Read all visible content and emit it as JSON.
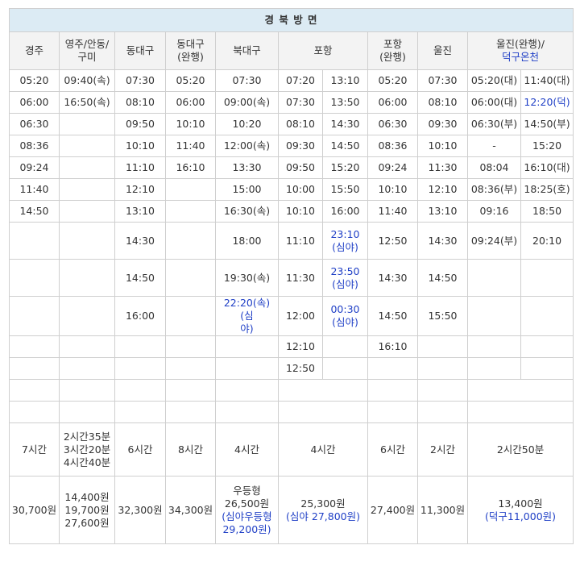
{
  "title": "경 북 방 면",
  "headers": {
    "gyeongju": "경주",
    "yeongju_1": "영주/안동/",
    "yeongju_2": "구미",
    "dongdaegu": "동대구",
    "dongdaegu_express_1": "동대구",
    "dongdaegu_express_2": "(완행)",
    "bukdaegu": "북대구",
    "pohang": "포항",
    "pohang_express_1": "포항",
    "pohang_express_2": "(완행)",
    "uljin": "울진",
    "uljin_express_1": "울진(완행)/",
    "uljin_express_2": "덕구온천"
  },
  "rows": [
    {
      "c1": "05:20",
      "c2": "09:40(속)",
      "c3": "07:30",
      "c4": "05:20",
      "c5": "07:30",
      "c6a": "07:20",
      "c6b": "13:10",
      "c7": "05:20",
      "c8": "07:30",
      "c9a": "05:20(대)",
      "c9b": "11:40(대)"
    },
    {
      "c1": "06:00",
      "c2": "16:50(속)",
      "c3": "08:10",
      "c4": "06:00",
      "c5": "09:00(속)",
      "c6a": "07:30",
      "c6b": "13:50",
      "c7": "06:00",
      "c8": "08:10",
      "c9a": "06:00(대)",
      "c9b": "12:20(덕)"
    },
    {
      "c1": "06:30",
      "c2": "",
      "c3": "09:50",
      "c4": "10:10",
      "c5": "10:20",
      "c6a": "08:10",
      "c6b": "14:30",
      "c7": "06:30",
      "c8": "09:30",
      "c9a": "06:30(부)",
      "c9b": "14:50(부)"
    },
    {
      "c1": "08:36",
      "c2": "",
      "c3": "10:10",
      "c4": "11:40",
      "c5": "12:00(속)",
      "c6a": "09:30",
      "c6b": "14:50",
      "c7": "08:36",
      "c8": "10:10",
      "c9a": "-",
      "c9b": "15:20"
    },
    {
      "c1": "09:24",
      "c2": "",
      "c3": "11:10",
      "c4": "16:10",
      "c5": "13:30",
      "c6a": "09:50",
      "c6b": "15:20",
      "c7": "09:24",
      "c8": "11:30",
      "c9a": "08:04",
      "c9b": "16:10(대)"
    },
    {
      "c1": "11:40",
      "c2": "",
      "c3": "12:10",
      "c4": "",
      "c5": "15:00",
      "c6a": "10:00",
      "c6b": "15:50",
      "c7": "10:10",
      "c8": "12:10",
      "c9a": "08:36(부)",
      "c9b": "18:25(호)"
    },
    {
      "c1": "14:50",
      "c2": "",
      "c3": "13:10",
      "c4": "",
      "c5": "16:30(속)",
      "c6a": "10:10",
      "c6b": "16:00",
      "c7": "11:40",
      "c8": "13:10",
      "c9a": "09:16",
      "c9b": "18:50"
    },
    {
      "c1": "",
      "c2": "",
      "c3": "14:30",
      "c4": "",
      "c5": "18:00",
      "c6a": "11:10",
      "c6b_1": "23:10",
      "c6b_2": "(심야)",
      "c7": "12:50",
      "c8": "14:30",
      "c9a": "09:24(부)",
      "c9b": "20:10"
    },
    {
      "c1": "",
      "c2": "",
      "c3": "14:50",
      "c4": "",
      "c5": "19:30(속)",
      "c6a": "11:30",
      "c6b_1": "23:50",
      "c6b_2": "(심야)",
      "c7": "14:30",
      "c8": "14:50",
      "c9a": "",
      "c9b": ""
    },
    {
      "c1": "",
      "c2": "",
      "c3": "16:00",
      "c4": "",
      "c5_1": "22:20(속)(심",
      "c5_2": "야)",
      "c6a": "12:00",
      "c6b_1": "00:30",
      "c6b_2": "(심야)",
      "c7": "14:50",
      "c8": "15:50",
      "c9a": "",
      "c9b": ""
    },
    {
      "c1": "",
      "c2": "",
      "c3": "",
      "c4": "",
      "c5": "",
      "c6a": "12:10",
      "c6b": "",
      "c7": "16:10",
      "c8": "",
      "c9a": "",
      "c9b": ""
    },
    {
      "c1": "",
      "c2": "",
      "c3": "",
      "c4": "",
      "c5": "",
      "c6a": "12:50",
      "c6b": "",
      "c7": "",
      "c8": "",
      "c9a": "",
      "c9b": ""
    }
  ],
  "duration": {
    "c1": "7시간",
    "c2_1": "2시간35분",
    "c2_2": "3시간20분",
    "c2_3": "4시간40분",
    "c3": "6시간",
    "c4": "8시간",
    "c5": "4시간",
    "c6": "4시간",
    "c7": "6시간",
    "c8": "2시간",
    "c9": "2시간50분"
  },
  "fare": {
    "c1": "30,700원",
    "c2_1": "14,400원",
    "c2_2": "19,700원",
    "c2_3": "27,600원",
    "c3": "32,300원",
    "c4": "34,300원",
    "c5_1": "우등형",
    "c5_2": "26,500원",
    "c5_3": "(심야우등형",
    "c5_4": "29,200원)",
    "c6_1": "25,300원",
    "c6_2": "(심야 27,800원)",
    "c7": "27,400원",
    "c8": "11,300원",
    "c9_1": "13,400원",
    "c9_2": "(덕구11,000원)"
  },
  "colors": {
    "title_bg": "#dcebf4",
    "header_bg": "#f3f3f3",
    "border": "#cfcfcf",
    "highlight_text": "#1f3fc6"
  }
}
